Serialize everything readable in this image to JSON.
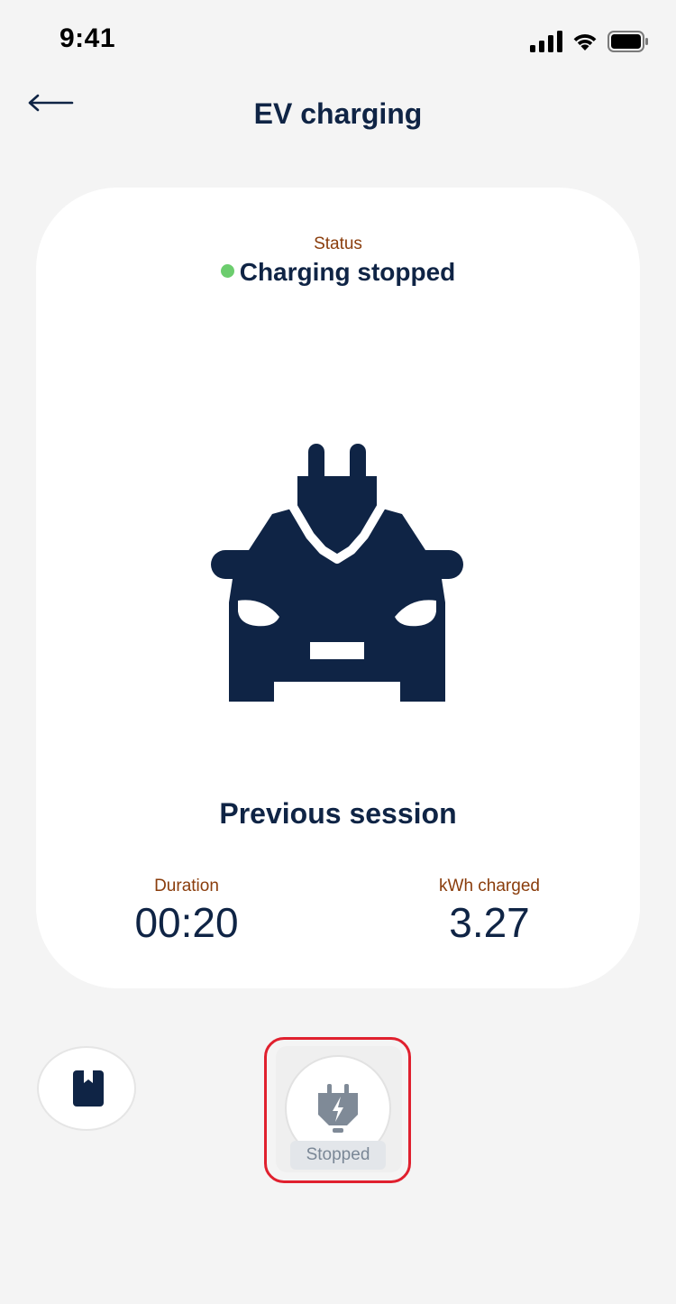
{
  "status_bar": {
    "time": "9:41"
  },
  "header": {
    "title": "EV charging"
  },
  "card": {
    "status_label": "Status",
    "status_value": "Charging stopped",
    "session_title": "Previous session",
    "stats": [
      {
        "label": "Duration",
        "value": "00:20"
      },
      {
        "label": "kWh charged",
        "value": "3.27"
      }
    ]
  },
  "actions": {
    "charge_state_label": "Stopped"
  },
  "colors": {
    "navy": "#0f2445",
    "label_brown": "#8a3d0c",
    "status_green": "#6ccd6e",
    "highlight_red": "#e0202e",
    "inactive_gray": "#7a8796"
  },
  "icons": {
    "back": "arrow-left-icon",
    "car": "ev-car-plug-icon",
    "bookmark": "bookmark-icon",
    "charge": "plug-bolt-icon"
  }
}
